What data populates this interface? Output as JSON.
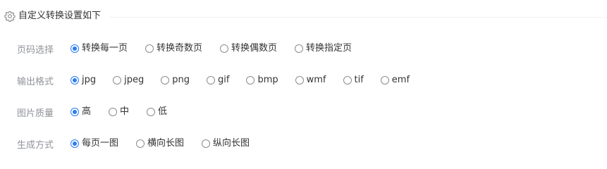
{
  "section": {
    "title": "自定义转换设置如下",
    "icon": "gear-icon"
  },
  "colors": {
    "accent": "#2b7cf6",
    "label": "#909399",
    "text": "#333333"
  },
  "page_select": {
    "label": "页码选择",
    "options": [
      "转换每一页",
      "转换奇数页",
      "转换偶数页",
      "转换指定页"
    ],
    "selected": "转换每一页"
  },
  "output_format": {
    "label": "输出格式",
    "options": [
      "jpg",
      "jpeg",
      "png",
      "gif",
      "bmp",
      "wmf",
      "tif",
      "emf"
    ],
    "selected": "jpg"
  },
  "image_quality": {
    "label": "图片质量",
    "options": [
      "高",
      "中",
      "低"
    ],
    "selected": "高"
  },
  "generate_mode": {
    "label": "生成方式",
    "options": [
      "每页一图",
      "横向长图",
      "纵向长图"
    ],
    "selected": "每页一图"
  }
}
